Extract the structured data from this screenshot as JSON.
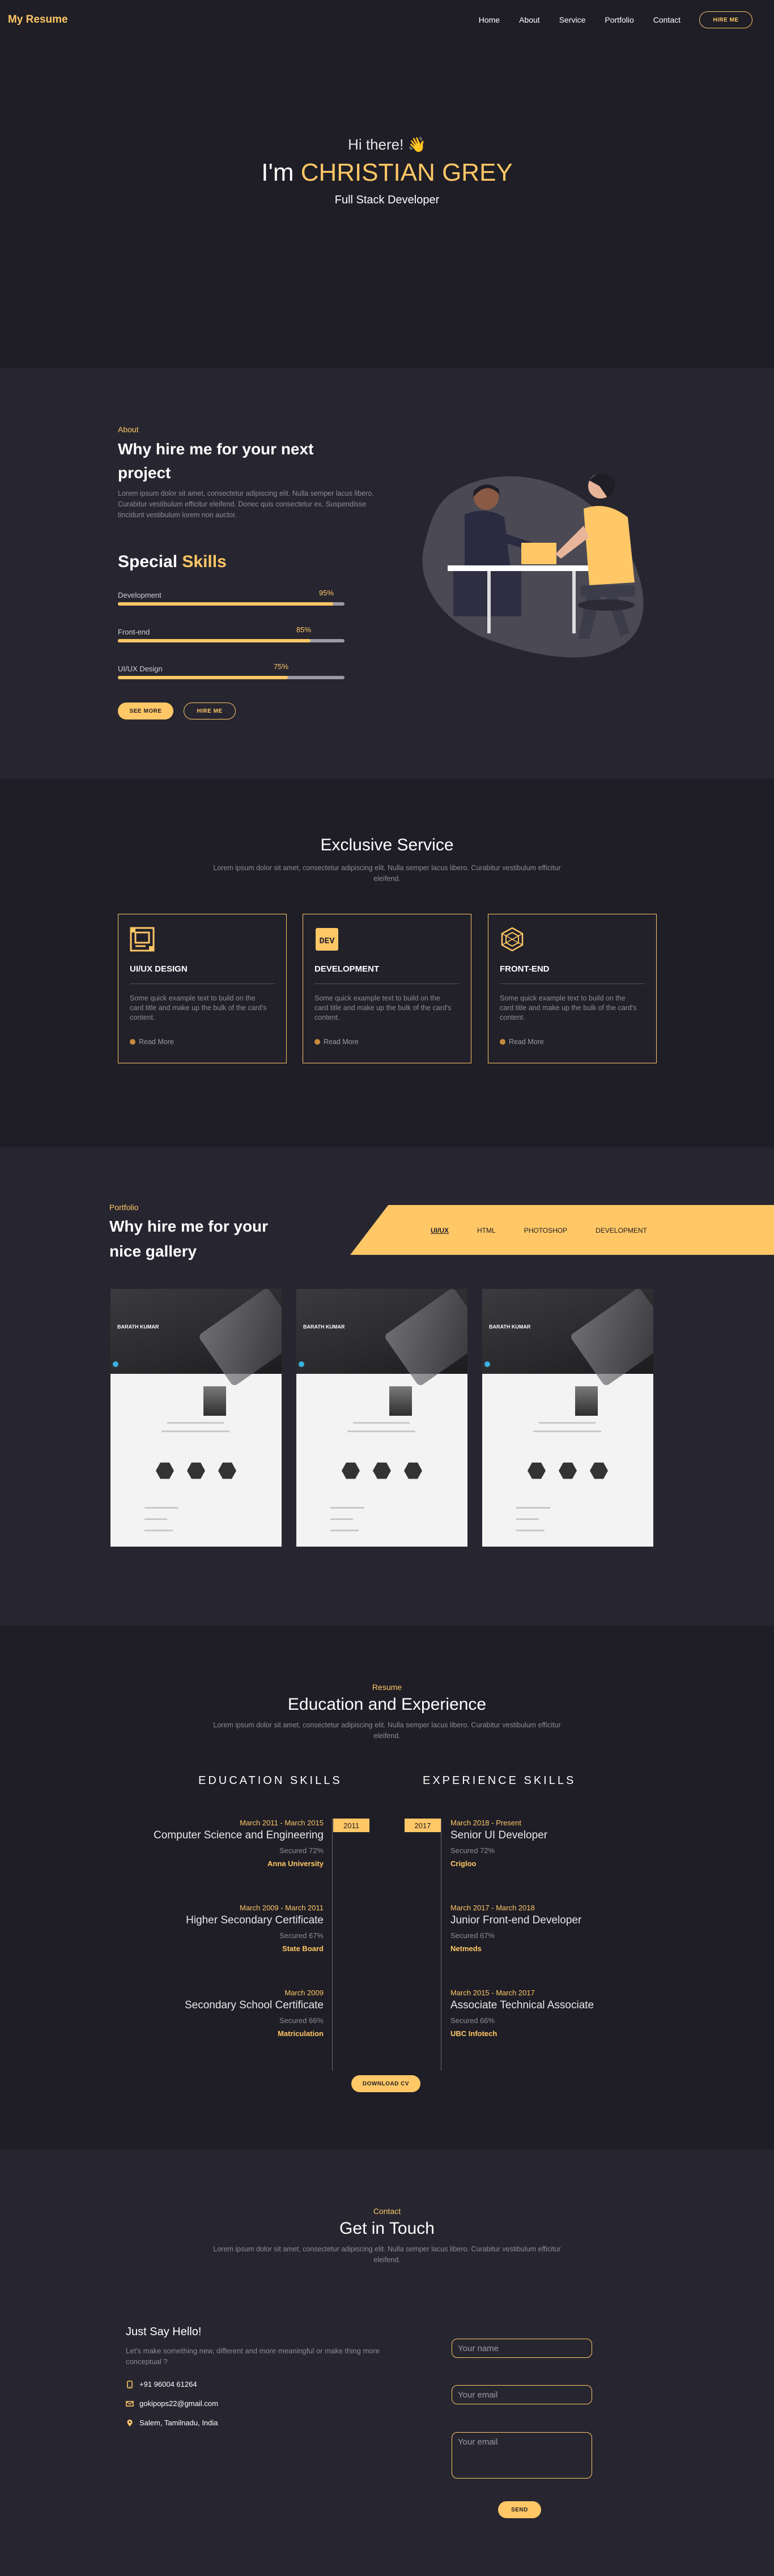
{
  "nav": {
    "logo": "My Resume",
    "links": [
      "Home",
      "About",
      "Service",
      "Portfolio",
      "Contact"
    ],
    "hire": "HIRE ME"
  },
  "hero": {
    "greeting": "Hi there! 👋",
    "im": "I'm ",
    "name": "CHRISTIAN GREY",
    "role": "Full Stack Developer"
  },
  "about": {
    "tag": "About",
    "title": "Why hire me for your next project",
    "text": "Lorem ipsum dolor sit amet, consectetur adipiscing elit. Nulla semper lacus libero. Curabitur vestibulum efficitur eleifend. Donec quis consectetur ex. Suspendisse tincidunt vestibulum lorem non auctor.",
    "skills_title_a": "Special ",
    "skills_title_b": "Skills",
    "skills": [
      {
        "label": "Development",
        "pct": "95%",
        "value": 0.95
      },
      {
        "label": "Front-end",
        "pct": "85%",
        "value": 0.85
      },
      {
        "label": "UI/UX Design",
        "pct": "75%",
        "value": 0.75
      }
    ],
    "see_more": "SEE MORE",
    "hire": "HIRE ME"
  },
  "services": {
    "title": "Exclusive Service",
    "subtitle": "Lorem ipsum dolor sit amet, consectetur adipiscing elit. Nulla semper lacus libero. Curabitur vestibulum efficitur eleifend.",
    "cards": [
      {
        "title": "UI/UX DESIGN",
        "text": "Some quick example text to build on the card title and make up the bulk of the card's content.",
        "read": "Read More",
        "icon": "design-icon"
      },
      {
        "title": "DEVELOPMENT",
        "text": "Some quick example text to build on the card title and make up the bulk of the card's content.",
        "read": "Read More",
        "icon": "dev-icon"
      },
      {
        "title": "FRONT-END",
        "text": "Some quick example text to build on the card title and make up the bulk of the card's content.",
        "read": "Read More",
        "icon": "frontend-icon"
      }
    ]
  },
  "portfolio": {
    "tag": "Portfolio",
    "title": "Why hire me for your nice gallery",
    "tabs": [
      "UI/UX",
      "HTML",
      "PHOTOSHOP",
      "DEVELOPMENT"
    ],
    "item_name": "BARATH KUMAR"
  },
  "resume": {
    "tag": "Resume",
    "title": "Education and Experience",
    "subtitle": "Lorem ipsum dolor sit amet, consectetur adipiscing elit. Nulla semper lacus libero. Curabitur vestibulum efficitur eleifend.",
    "edu_head": "EDUCATION SKILLS",
    "exp_head": "EXPERIENCE SKILLS",
    "edu_year": "2011",
    "exp_year": "2017",
    "education": [
      {
        "date": "March 2011 - March 2015",
        "title": "Computer Science and Engineering",
        "score": "Secured 72%",
        "org": "Anna University"
      },
      {
        "date": "March 2009 - March 2011",
        "title": "Higher Secondary Certificate",
        "score": "Secured 67%",
        "org": "State Board"
      },
      {
        "date": "March 2009",
        "title": "Secondary School Certificate",
        "score": "Secured 66%",
        "org": "Matriculation"
      }
    ],
    "experience": [
      {
        "date": "March 2018 - Present",
        "title": "Senior UI Developer",
        "score": "Secured 72%",
        "org": "Crigloo"
      },
      {
        "date": "March 2017 - March 2018",
        "title": "Junior Front-end Developer",
        "score": "Secured 67%",
        "org": "Netmeds"
      },
      {
        "date": "March 2015 - March 2017",
        "title": "Associate Technical Associate",
        "score": "Secured 66%",
        "org": "UBC Infotech"
      }
    ],
    "download": "DOWNLOAD CV"
  },
  "contact": {
    "tag": "Contact",
    "title": "Get in Touch",
    "subtitle": "Lorem ipsum dolor sit amet, consectetur adipiscing elit. Nulla semper lacus libero. Curabitur vestibulum efficitur eleifend.",
    "say": "Just Say Hello!",
    "say_text": "Let's make something new, different and more meaningful or make thing more conceptual ?",
    "phone": "+91 96004 61264",
    "email": "gokipops22@gmail.com",
    "address": "Salem, Tamilnadu, India",
    "name_ph": "Your name",
    "email_ph": "Your email",
    "msg_ph": "Your email",
    "send": "SEND"
  },
  "colors": {
    "accent": "#ffc766",
    "bg": "#1f1e26",
    "bg_alt": "#272630"
  }
}
